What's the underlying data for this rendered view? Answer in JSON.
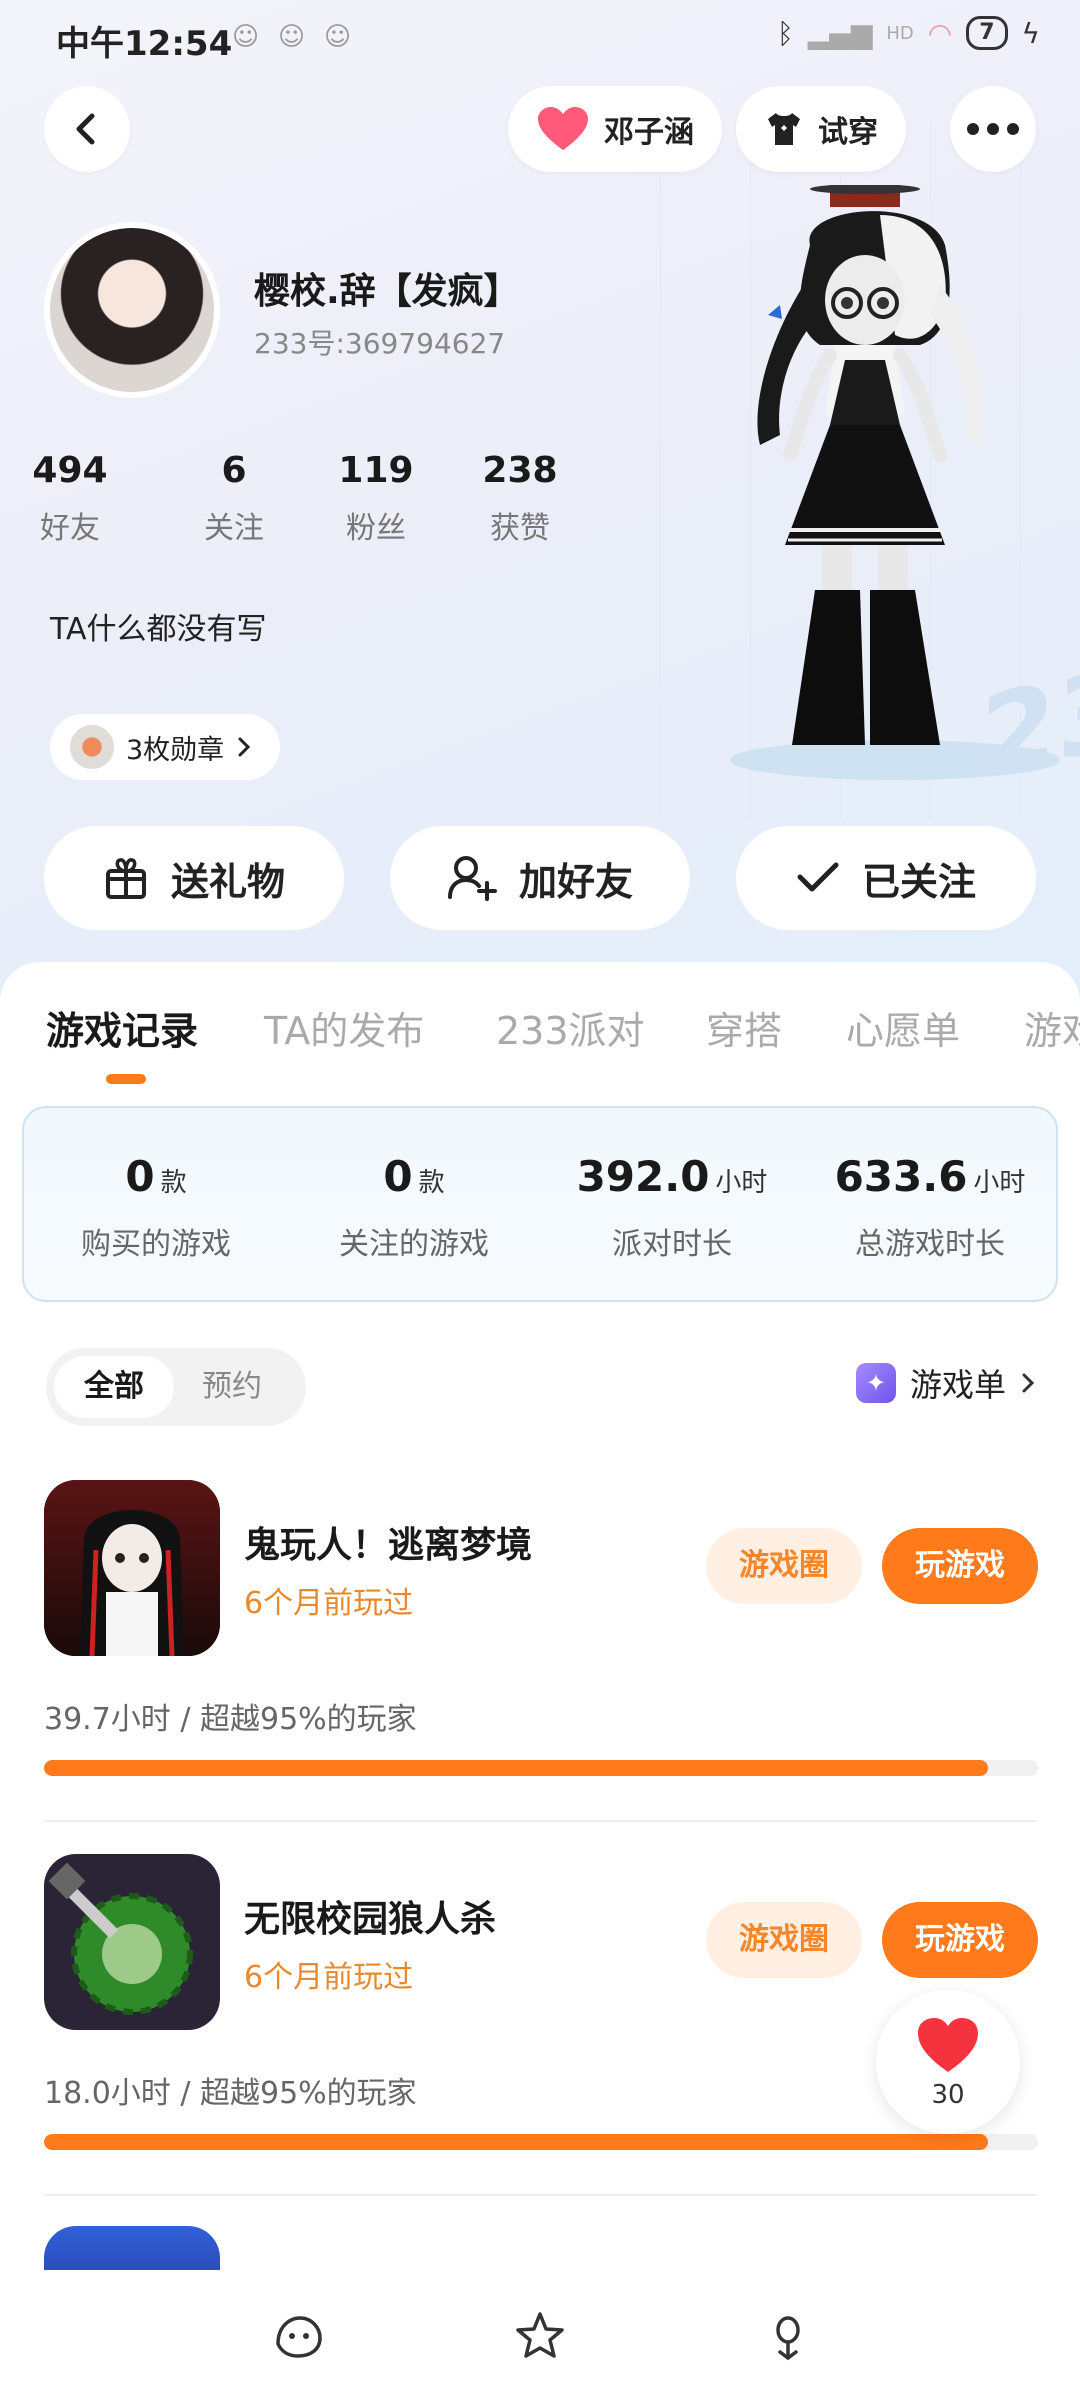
{
  "status_bar": {
    "time": "中午12:54",
    "battery": "7",
    "network": "HD"
  },
  "header": {
    "friend_name": "邓子涵",
    "try_on": "试穿"
  },
  "profile": {
    "name": "樱校.辞【发疯】",
    "uid": "233号:369794627",
    "bio": "TA什么都没有写",
    "medal": "3枚勋章",
    "stats": [
      {
        "value": "494",
        "label": "好友"
      },
      {
        "value": "6",
        "label": "关注"
      },
      {
        "value": "119",
        "label": "粉丝"
      },
      {
        "value": "238",
        "label": "获赞"
      }
    ]
  },
  "actions": {
    "gift": "送礼物",
    "add_friend": "加好友",
    "followed": "已关注"
  },
  "tabs": [
    "游戏记录",
    "TA的发布",
    "233派对",
    "穿搭",
    "心愿单",
    "游戏"
  ],
  "active_tab": "游戏记录",
  "summary": [
    {
      "value": "0",
      "unit": "款",
      "label": "购买的游戏"
    },
    {
      "value": "0",
      "unit": "款",
      "label": "关注的游戏"
    },
    {
      "value": "392.0",
      "unit": "小时",
      "label": "派对时长"
    },
    {
      "value": "633.6",
      "unit": "小时",
      "label": "总游戏时长"
    }
  ],
  "filter": {
    "all": "全部",
    "reserved": "预约",
    "game_list": "游戏单"
  },
  "games": [
    {
      "title": "鬼玩人！逃离梦境",
      "played": "6个月前玩过",
      "circle_button": "游戏圈",
      "play_button": "玩游戏",
      "stats": "39.7小时 / 超越95%的玩家",
      "progress_percent": 95
    },
    {
      "title": "无限校园狼人杀",
      "played": "6个月前玩过",
      "circle_button": "游戏圈",
      "play_button": "玩游戏",
      "stats": "18.0小时 / 超越95%的玩家",
      "progress_percent": 95
    }
  ],
  "like_fab": {
    "count": "30"
  },
  "colors": {
    "accent": "#ff7a1a",
    "accent_soft": "#fff0e3",
    "played_text": "#e8892b"
  }
}
